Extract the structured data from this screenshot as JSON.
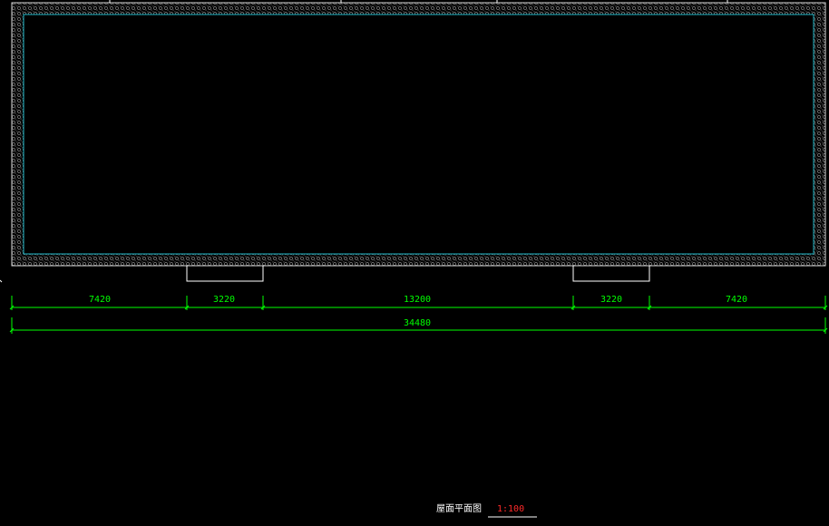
{
  "plan": {
    "title": "屋面平面图",
    "scale": "1:100"
  },
  "dimensions": {
    "segments": [
      "7420",
      "3220",
      "13200",
      "3220",
      "7420"
    ],
    "total": "34480"
  },
  "colors": {
    "background": "#000000",
    "dimension": "#00ff00",
    "parapet_inner": "#1fb8c9",
    "outline": "#ffffff",
    "scale": "#ff2a2a"
  }
}
